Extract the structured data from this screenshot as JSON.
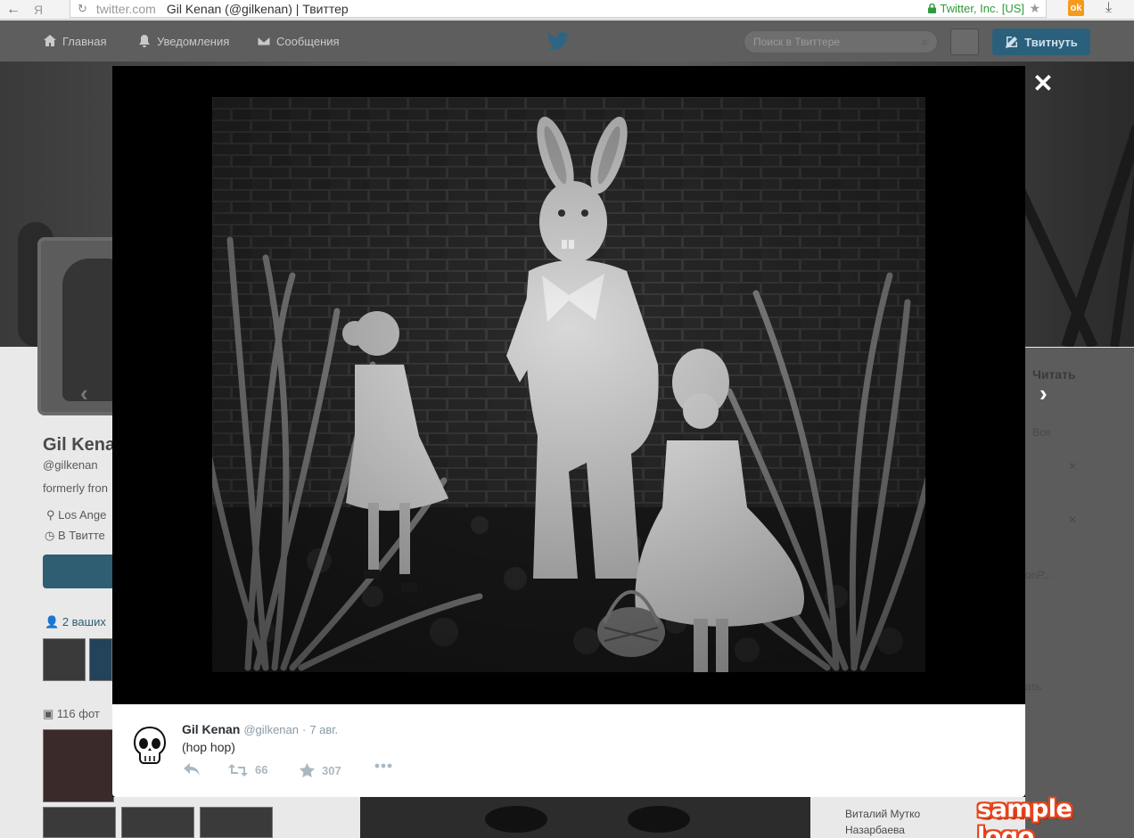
{
  "browser": {
    "host": "twitter.com",
    "page_title": "Gil Kenan (@gilkenan) | Твиттер",
    "cert": "Twitter, Inc. [US]",
    "yandex_glyph": "Я",
    "ok_glyph": "ok"
  },
  "nav": {
    "home": "Главная",
    "notifications": "Уведомления",
    "messages": "Сообщения",
    "search_placeholder": "Поиск в Твиттере",
    "tweet_button": "Твитнуть"
  },
  "profile_bg": {
    "name": "Gil Kenan",
    "handle": "@gilkenan",
    "bio": "formerly fron",
    "location": "Los Ange",
    "joined": "В Твитте",
    "followers_hint": "2 ваших",
    "photos": "116 фот",
    "follow_right": "Читать",
    "all": "Все",
    "right_snippet_1": "onP...",
    "right_snippet_2": "ать",
    "right_names": [
      "Виталий Мутко",
      "Назарбаева"
    ]
  },
  "tweet": {
    "name": "Gil Kenan",
    "handle": "@gilkenan",
    "separator": "·",
    "date": "7 авг.",
    "text": "(hop hop)",
    "retweets": "66",
    "favorites": "307"
  },
  "icons": {
    "close": "close-icon",
    "prev": "chevron-left-icon",
    "next": "chevron-right-icon",
    "reply": "reply-icon",
    "retweet": "retweet-icon",
    "favorite": "star-icon",
    "more": "more-icon"
  },
  "watermark": "sample logo",
  "colors": {
    "accent": "#2b607c",
    "modal_bg": "#000000",
    "watermark": "#e8441c"
  }
}
